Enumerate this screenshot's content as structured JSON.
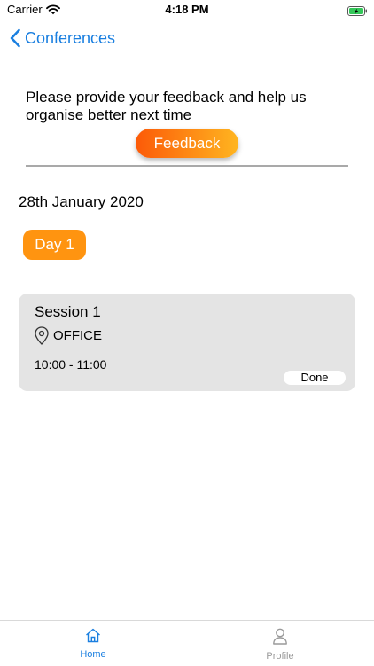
{
  "status_bar": {
    "carrier": "Carrier",
    "time": "4:18 PM"
  },
  "nav": {
    "back_label": "Conferences"
  },
  "feedback": {
    "prompt": "Please provide your feedback and help us organise better next time",
    "button_label": "Feedback"
  },
  "schedule": {
    "date": "28th January 2020",
    "day_label": "Day 1",
    "sessions": [
      {
        "title": "Session 1",
        "location": "OFFICE",
        "time": "10:00 - 11:00",
        "status": "Done"
      }
    ]
  },
  "tabbar": {
    "items": [
      {
        "label": "Home"
      },
      {
        "label": "Profile"
      }
    ]
  },
  "colors": {
    "accent_blue": "#1a7fe0",
    "feedback_gradient_start": "#fc5a08",
    "feedback_gradient_end": "#ffb520",
    "day_orange": "#ff9410",
    "card_gray": "#e4e4e4",
    "battery_green": "#34c759"
  },
  "icons": {
    "back": "chevron-left-icon",
    "location": "map-pin-icon",
    "home": "home-icon",
    "profile": "user-icon"
  }
}
